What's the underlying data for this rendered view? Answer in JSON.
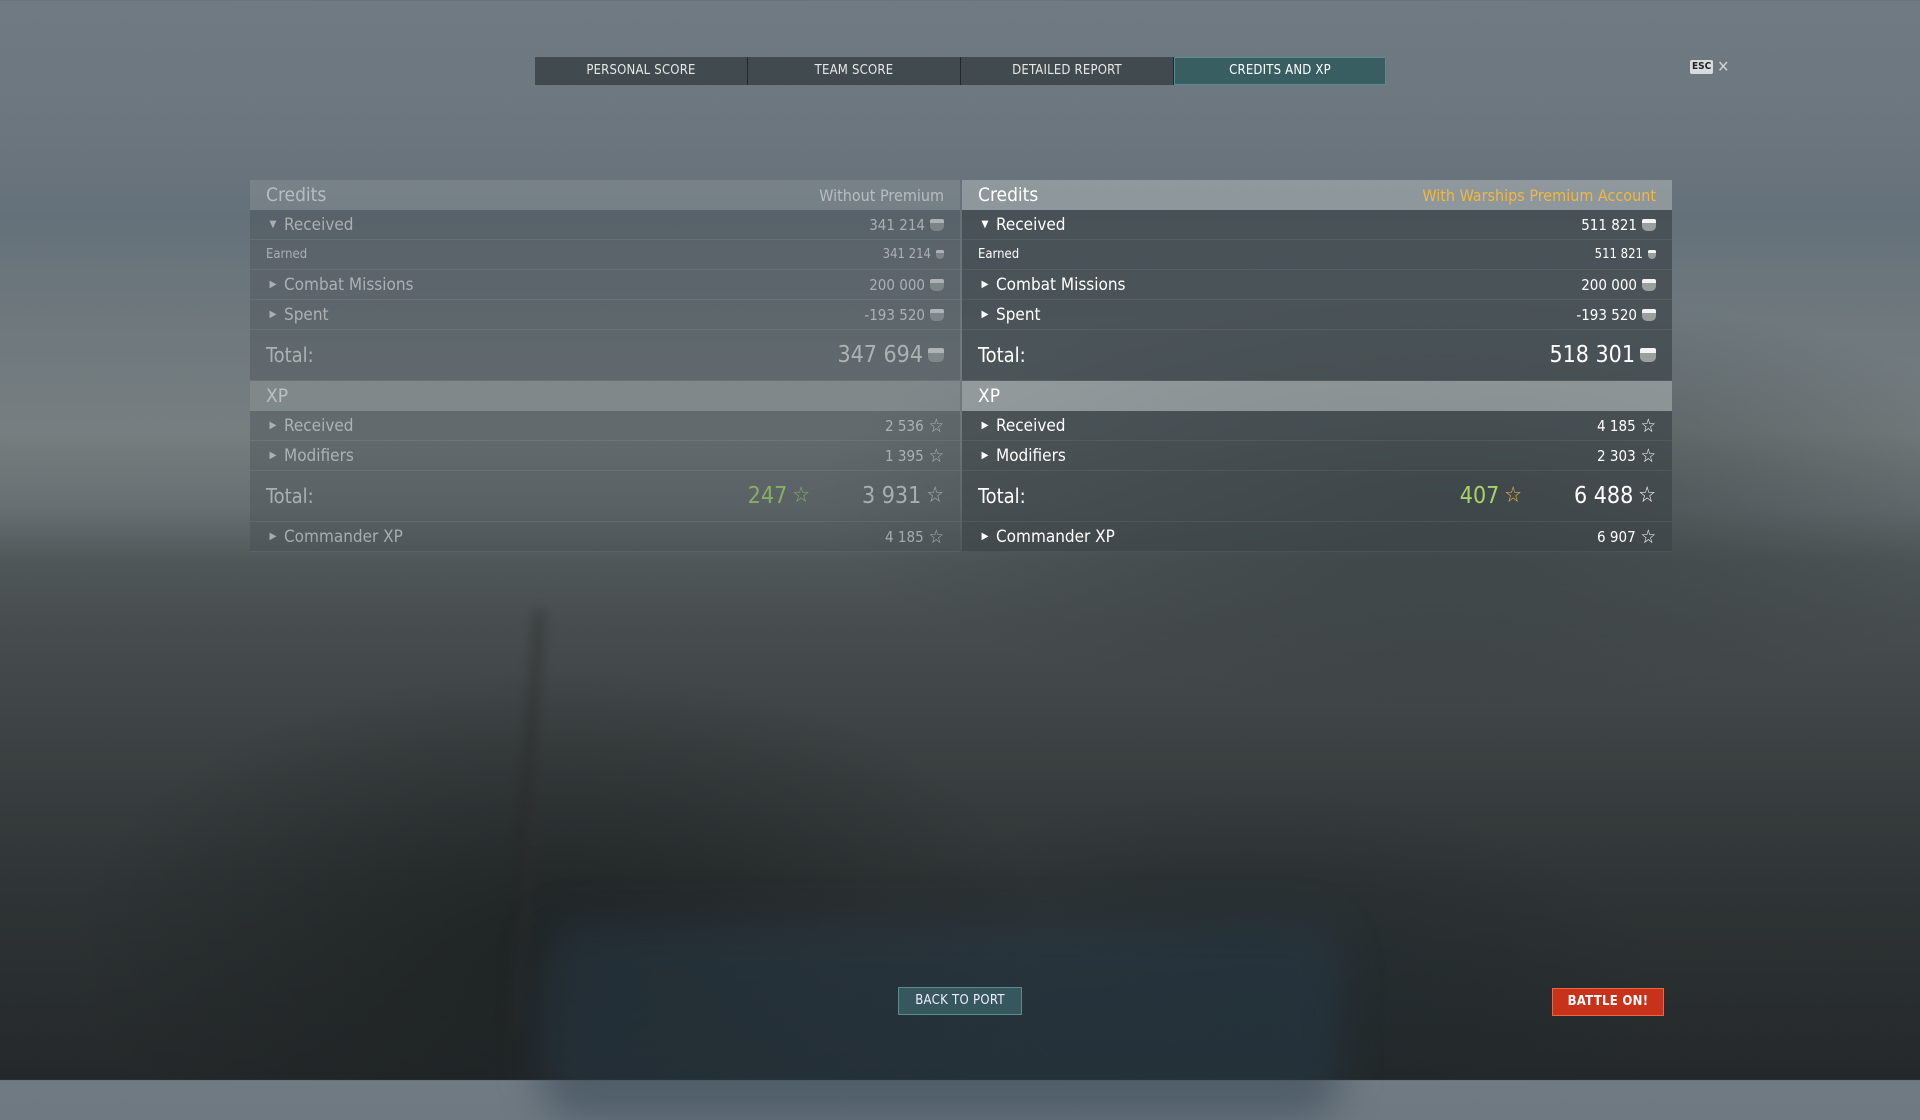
{
  "tabs": [
    {
      "label": "PERSONAL SCORE"
    },
    {
      "label": "TEAM SCORE"
    },
    {
      "label": "DETAILED REPORT"
    },
    {
      "label": "CREDITS AND XP"
    }
  ],
  "esc": {
    "key": "ESC",
    "close": "✕"
  },
  "left": {
    "credits_title": "Credits",
    "credits_subtitle": "Without Premium",
    "received": {
      "label": "Received",
      "value": "341 214"
    },
    "earned": {
      "label": "Earned",
      "value": "341 214"
    },
    "combat_missions": {
      "label": "Combat Missions",
      "value": "200 000"
    },
    "spent": {
      "label": "Spent",
      "value": "-193 520"
    },
    "credits_total": {
      "label": "Total:",
      "value": "347 694"
    },
    "xp_title": "XP",
    "xp_received": {
      "label": "Received",
      "value": "2 536"
    },
    "modifiers": {
      "label": "Modifiers",
      "value": "1 395"
    },
    "xp_total": {
      "label": "Total:",
      "free_value": "247",
      "value": "3 931"
    },
    "commander_xp": {
      "label": "Commander XP",
      "value": "4 185"
    }
  },
  "right": {
    "credits_title": "Credits",
    "credits_subtitle": "With Warships Premium Account",
    "received": {
      "label": "Received",
      "value": "511 821"
    },
    "earned": {
      "label": "Earned",
      "value": "511 821"
    },
    "combat_missions": {
      "label": "Combat Missions",
      "value": "200 000"
    },
    "spent": {
      "label": "Spent",
      "value": "-193 520"
    },
    "credits_total": {
      "label": "Total:",
      "value": "518 301"
    },
    "xp_title": "XP",
    "xp_received": {
      "label": "Received",
      "value": "4 185"
    },
    "modifiers": {
      "label": "Modifiers",
      "value": "2 303"
    },
    "xp_total": {
      "label": "Total:",
      "free_value": "407",
      "value": "6 488"
    },
    "commander_xp": {
      "label": "Commander XP",
      "value": "6 907"
    }
  },
  "buttons": {
    "back": "BACK TO PORT",
    "battle": "BATTLE ON!"
  },
  "colors": {
    "premium_accent": "#f0b840",
    "free_xp_green": "#a8d36a",
    "battle_button": "#c8321b",
    "active_tab": "#345c60"
  }
}
